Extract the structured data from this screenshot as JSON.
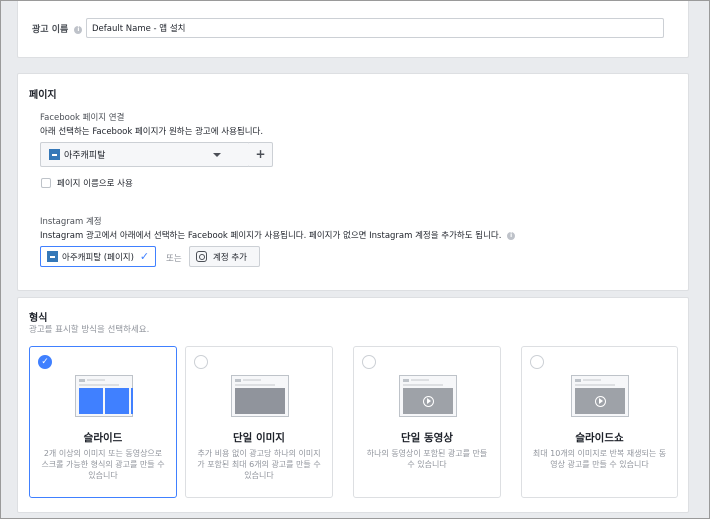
{
  "ad_name": {
    "label": "광고 이름",
    "value": "Default Name - 앱 설치"
  },
  "page_section": {
    "title": "페이지",
    "facebook": {
      "title": "Facebook 페이지 연결",
      "description": "아래 선택하는 Facebook 페이지가 원하는 광고에 사용됩니다.",
      "selected_page": "아주캐피탈",
      "add_label": "+",
      "use_page_name_label": "페이지 이름으로 사용"
    },
    "instagram": {
      "title": "Instagram 계정",
      "description": "Instagram 광고에서 아래에서 선택하는 Facebook 페이지가 사용됩니다. 페이지가 없으면 Instagram 계정을 추가하도 됩니다.",
      "selected_account": "아주캐피탈 (페이지)",
      "or_label": "또는",
      "add_account_label": "계정 추가"
    }
  },
  "format_section": {
    "title": "형식",
    "subtitle": "광고를 표시할 방식을 선택하세요.",
    "options": [
      {
        "title": "슬라이드",
        "description": "2개 이상의 이미지 또는 동영상으로 스크롤 가능한 형식의 광고를 만들 수 있습니다",
        "selected": true,
        "thumb": "carousel"
      },
      {
        "title": "단일 이미지",
        "description": "추가 비용 없이 광고당 하나의 이미지가 포함된 최대 6개의 광고를 만들 수 있습니다",
        "selected": false,
        "thumb": "image"
      },
      {
        "title": "단일 동영상",
        "description": "하나의 동영상이 포함된 광고를 만들 수 있습니다",
        "selected": false,
        "thumb": "video"
      },
      {
        "title": "슬라이드쇼",
        "description": "최대 10개의 이미지로 반복 재생되는 동영상 광고를 만들 수 있습니다",
        "selected": false,
        "thumb": "video"
      }
    ]
  },
  "colors": {
    "accent": "#4080ff",
    "page_background": "#e9ebee"
  },
  "icons": {
    "info": "info-icon",
    "dropdown": "chevron-down-icon",
    "check": "check-icon",
    "instagram": "instagram-icon",
    "play": "play-icon"
  }
}
